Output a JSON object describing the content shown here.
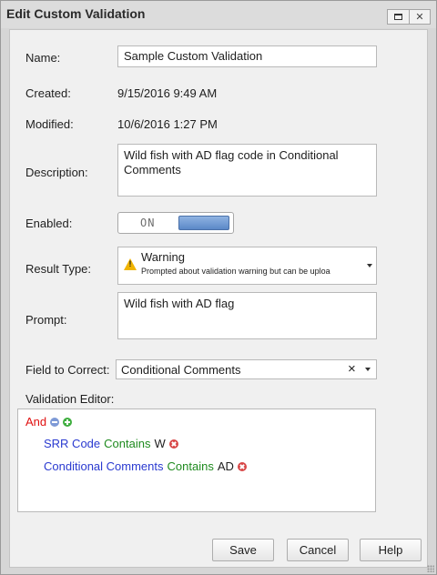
{
  "window": {
    "title": "Edit Custom Validation"
  },
  "form": {
    "name_label": "Name:",
    "name_value": "Sample Custom Validation",
    "created_label": "Created:",
    "created_value": "9/15/2016 9:49 AM",
    "modified_label": "Modified:",
    "modified_value": "10/6/2016 1:27 PM",
    "description_label": "Description:",
    "description_value": "Wild fish with AD flag code in Conditional Comments",
    "enabled_label": "Enabled:",
    "enabled_state": "ON",
    "result_type_label": "Result Type:",
    "result_type_value": "Warning",
    "result_type_description": "Prompted about validation warning but can be uploa",
    "result_type_icon": "warning-triangle-icon",
    "prompt_label": "Prompt:",
    "prompt_value": "Wild fish with AD flag",
    "field_to_correct_label": "Field to Correct:",
    "field_to_correct_value": "Conditional Comments",
    "clear_glyph": "×"
  },
  "editor": {
    "label": "Validation Editor:",
    "root_operator": "And",
    "rules": [
      {
        "field": "SRR Code",
        "operator": "Contains",
        "value": "W"
      },
      {
        "field": "Conditional Comments",
        "operator": "Contains",
        "value": "AD"
      }
    ]
  },
  "buttons": {
    "save": "Save",
    "cancel": "Cancel",
    "help": "Help"
  },
  "colors": {
    "operator_and": "#e01010",
    "rule_field": "#2a3ad0",
    "rule_operator": "#1f8a1f",
    "toggle_on": "#5b88c7",
    "warning": "#f0b400"
  }
}
